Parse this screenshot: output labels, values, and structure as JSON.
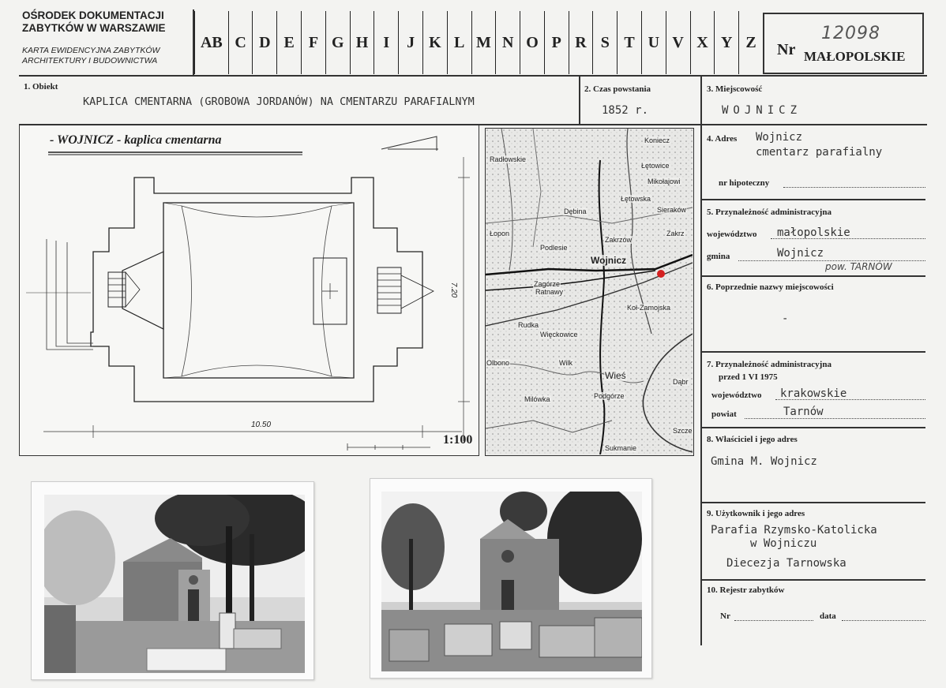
{
  "header": {
    "institution": "OŚRODEK DOKUMENTACJI ZABYTKÓW W WARSZAWIE",
    "card_type": "KARTA EWIDENCYJNA ZABYTKÓW ARCHITEKTURY I BUDOWNICTWA",
    "letters": [
      "AB",
      "C",
      "D",
      "E",
      "F",
      "G",
      "H",
      "I",
      "J",
      "K",
      "L",
      "M",
      "N",
      "O",
      "P",
      "R",
      "S",
      "T",
      "U",
      "V",
      "X",
      "Y",
      "Z"
    ],
    "nr_label": "Nr",
    "reg_number": "12098",
    "region": "MAŁOPOLSKIE"
  },
  "fields": {
    "obiekt_label": "1. Obiekt",
    "obiekt_value": "KAPLICA CMENTARNA (GROBOWA JORDANÓW) NA CMENTARZU PARAFIALNYM",
    "czas_label": "2. Czas powstania",
    "czas_value": "1852 r.",
    "miejscowosc_label": "3. Miejscowość",
    "miejscowosc_value": "WOJNICZ",
    "adres_label": "4. Adres",
    "adres_line1": "Wojnicz",
    "adres_line2": "cmentarz parafialny",
    "hipoteczny_label": "nr hipoteczny",
    "admin_label": "5. Przynależność administracyjna",
    "woj_label": "województwo",
    "woj_value": "małopolskie",
    "gmina_label": "gmina",
    "gmina_value": "Wojnicz",
    "pow_note": "pow. TARNÓW",
    "poprzednie_label": "6. Poprzednie nazwy miejscowości",
    "poprzednie_value": "-",
    "admin_before_label": "7. Przynależność administracyjna",
    "admin_before_sub": "przed 1 VI 1975",
    "woj_before_label": "województwo",
    "woj_before_value": "krakowskie",
    "powiat_label": "powiat",
    "powiat_value": "Tarnów",
    "wlasciciel_label": "8. Właściciel i jego adres",
    "wlasciciel_value": "Gmina M. Wojnicz",
    "uzytkownik_label": "9. Użytkownik i jego adres",
    "uzytkownik_line1": "Parafia Rzymsko-Katolicka",
    "uzytkownik_line2": "w Wojniczu",
    "uzytkownik_line3": "Diecezja Tarnowska",
    "rejestr_label": "10. Rejestr zabytków",
    "rejestr_nr": "Nr",
    "rejestr_data": "data"
  },
  "plan": {
    "title": "- WOJNICZ - kaplica cmentarna",
    "dim_width": "10.50",
    "dim_height": "7.20",
    "scale": "1:100"
  },
  "map": {
    "places": [
      "Koniecz",
      "Łętowice",
      "Radłowskie",
      "Mikołajowi",
      "Łętowska",
      "Dębina",
      "Sieraków",
      "Łopon",
      "Zakrzów",
      "Podlesie",
      "Wojnicz",
      "Zakrz",
      "Zagórze",
      "Ratnawy",
      "Koł-Zamojska",
      "Rudka",
      "Więckowice",
      "Wilk",
      "Wieś",
      "Dąbr",
      "Milówka",
      "Podgórze",
      "Szcze",
      "Olbono",
      "Sukmanie"
    ],
    "marker_color": "#d42020"
  }
}
